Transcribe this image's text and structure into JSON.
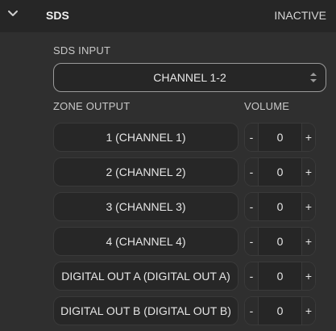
{
  "section": {
    "title": "SDS",
    "status": "INACTIVE"
  },
  "sds_input": {
    "label": "SDS INPUT",
    "value": "CHANNEL 1-2"
  },
  "zone_output": {
    "label": "ZONE OUTPUT",
    "volume_label": "VOLUME",
    "zones": [
      {
        "name": "1 (CHANNEL 1)",
        "volume": "0"
      },
      {
        "name": "2 (CHANNEL 2)",
        "volume": "0"
      },
      {
        "name": "3 (CHANNEL 3)",
        "volume": "0"
      },
      {
        "name": "4 (CHANNEL 4)",
        "volume": "0"
      },
      {
        "name": "DIGITAL OUT A (DIGITAL OUT A)",
        "volume": "0"
      },
      {
        "name": "DIGITAL OUT B (DIGITAL OUT B)",
        "volume": "0"
      }
    ],
    "minus_label": "-",
    "plus_label": "+"
  },
  "colors": {
    "background": "#2f2f2f",
    "header": "#262626",
    "text": "#e6e6e6"
  }
}
